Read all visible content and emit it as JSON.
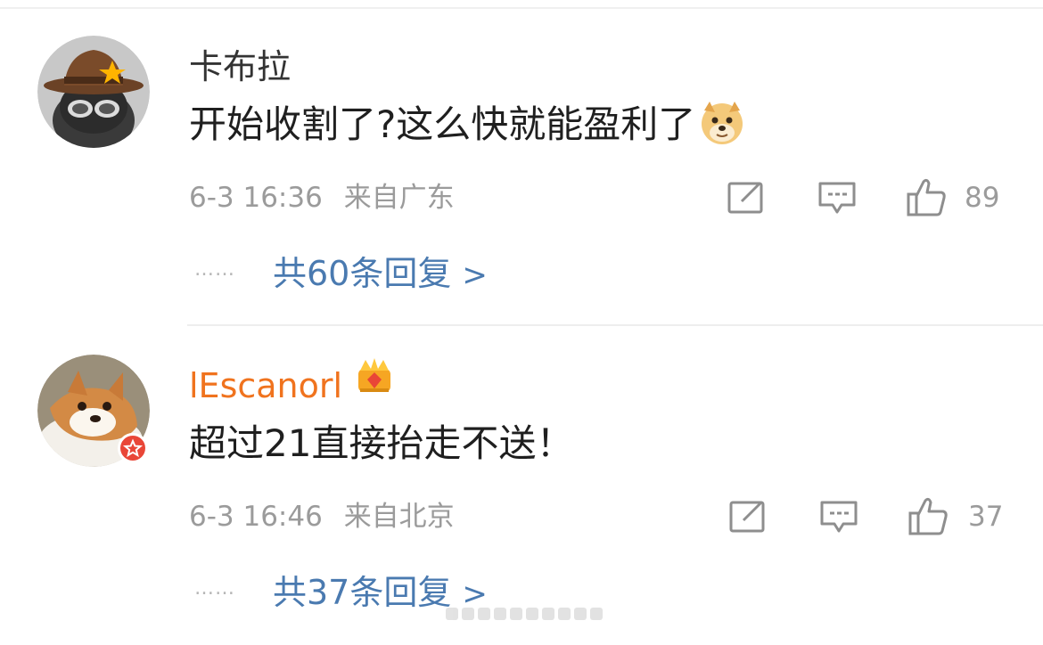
{
  "comments": [
    {
      "username": "卡布拉",
      "text": "开始收割了?这么快就能盈利了",
      "emoji": "doge-emoji",
      "time": "6-3 16:36",
      "location": "来自广东",
      "likes": "89",
      "dots": "……",
      "replies": "共60条回复",
      "replies_arrow": ">"
    },
    {
      "username": "lEscanorl",
      "badge": "crown-icon",
      "verified": "vip-star-badge",
      "text": "超过21直接抬走不送！",
      "time": "6-3 16:46",
      "location": "来自北京",
      "likes": "37",
      "dots": "……",
      "replies": "共37条回复",
      "replies_arrow": ">"
    }
  ],
  "colors": {
    "username_vip": "#f0731e",
    "reply_link": "#4a7ab0",
    "meta": "#9b9b9b",
    "badge_red": "#e94637"
  }
}
